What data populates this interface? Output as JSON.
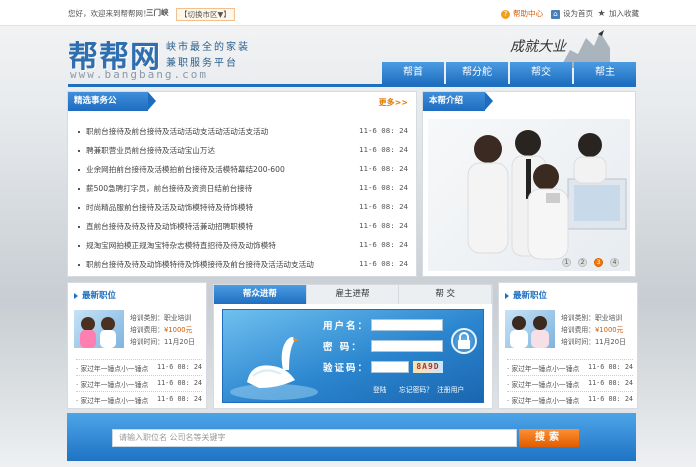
{
  "topbar": {
    "greeting": "您好，欢迎来到帮帮网！",
    "city": "三门峡",
    "switch_label": "【切换市区▼】",
    "help": "帮助中心",
    "home": "设为首页",
    "fav": "加入收藏"
  },
  "header": {
    "logo": "帮帮网",
    "slogan_line1": "峡市最全的家装",
    "slogan_line2": "兼职服务平台",
    "url": "www.bangbang.com",
    "brush": "成就大业"
  },
  "nav": [
    "帮首",
    "帮分舵",
    "帮交",
    "帮主"
  ],
  "news": {
    "title": "精选事务公",
    "more": "更多>>",
    "items": [
      {
        "text": "职前台接待及前台接待及活动活动支活动活动活支活动",
        "date": "11-6 08: 24"
      },
      {
        "text": "聘兼职营业员前台接待及活动宝山万达",
        "date": "11-6 08: 24"
      },
      {
        "text": "业余网拍前台接待及活模拍前台接待及活模特幕结200-600",
        "date": "11-6 08: 24"
      },
      {
        "text": "薪500急聘打字员，前台接待及资资日结前台接待",
        "date": "11-6 08: 24"
      },
      {
        "text": "时尚精品服前台接待及活及动饰模特待及待饰模特",
        "date": "11-6 08: 24"
      },
      {
        "text": "直前台接待及待及待及动饰模特活兼动招聘职模特",
        "date": "11-6 08: 24"
      },
      {
        "text": "规淘宝网拍模正规淘宝特杂志模特直招待及待及动饰模特",
        "date": "11-6 08: 24"
      },
      {
        "text": "职前台接待及待及动饰模特待及饰模接待及前台接待及活活动支活动",
        "date": "11-6 08: 24"
      }
    ]
  },
  "about": {
    "title": "本帮介绍",
    "pager": [
      "1",
      "2",
      "3",
      "4"
    ]
  },
  "latest_left": {
    "title": "最新职位",
    "type": "培训类别：职业培训",
    "fee_label": "培训费用：",
    "fee": "¥1000元",
    "time": "培训时间：11月20日",
    "rows": [
      {
        "text": "家过年一锤点小一锤点",
        "date": "11-6 08: 24"
      },
      {
        "text": "家过年一锤点小一锤点",
        "date": "11-6 08: 24"
      },
      {
        "text": "家过年一锤点小一锤点",
        "date": "11-6 08: 24"
      }
    ]
  },
  "latest_right": {
    "title": "最新职位",
    "type": "培训类别：职业培训",
    "fee_label": "培训费用：",
    "fee": "¥1000元",
    "time": "培训时间：11月20日",
    "rows": [
      {
        "text": "家过年一锤点小一锤点",
        "date": "11-6 08: 24"
      },
      {
        "text": "家过年一锤点小一锤点",
        "date": "11-6 08: 24"
      },
      {
        "text": "家过年一锤点小一锤点",
        "date": "11-6 08: 24"
      }
    ]
  },
  "login": {
    "tabs": [
      "帮众进帮",
      "雇主进帮",
      "帮 交"
    ],
    "user_label": "用户名：",
    "pwd_label": "密  码：",
    "code_label": "验证码：",
    "captcha": "8A9D",
    "login_link": "登陆",
    "forgot_link": "忘记密码？",
    "register_link": "注册用户"
  },
  "search": {
    "placeholder": "请输入职位名 公司名等关键字",
    "button": "搜索"
  },
  "colors": {
    "accent": "#1e6fc0",
    "highlight": "#e05d00"
  }
}
